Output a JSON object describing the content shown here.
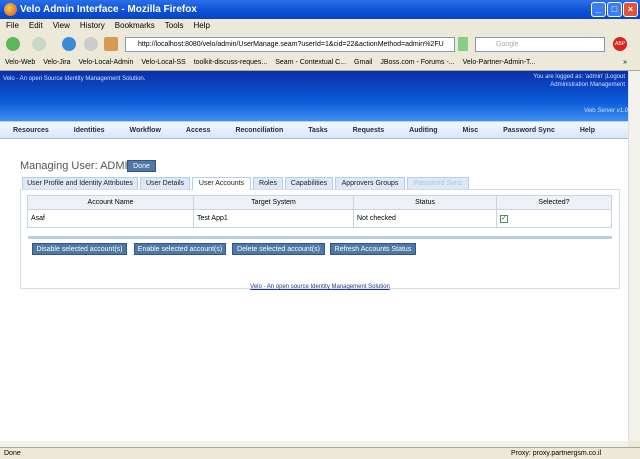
{
  "window": {
    "title": "Velo Admin Interface - Mozilla Firefox"
  },
  "menu": [
    "File",
    "Edit",
    "View",
    "History",
    "Bookmarks",
    "Tools",
    "Help"
  ],
  "toolbar": {
    "url": "http://localhost:8080/velo/admin/UserManage.seam?userId=1&cid=22&actionMethod=admin%2FU",
    "search_placeholder": "Google"
  },
  "bookmarks": [
    "Velo-Web",
    "Velo-Jira",
    "Velo-Local-Admin",
    "Velo-Local-SS",
    "toolkit-discuss-reques...",
    "Seam - Contextual C...",
    "Gmail",
    "JBoss.com - Forums -...",
    "Velo-Partner-Admin-T...",
    "»"
  ],
  "header": {
    "tagline": "Velo - An open Source Identity Management Solution.",
    "logged": "You are logged as: 'admin' |Logout",
    "admin": "Administration Management",
    "version": "Velo Server v1.0"
  },
  "nav": [
    "Resources",
    "Identities",
    "Workflow",
    "Access",
    "Reconciliation",
    "Tasks",
    "Requests",
    "Auditing",
    "Misc",
    "Password Sync",
    "Help"
  ],
  "page": {
    "title": "Managing User: ADMIN",
    "done": "Done"
  },
  "tabs": [
    "User Profile and Identity Attributes",
    "User Details",
    "User Accounts",
    "Roles",
    "Capabilities",
    "Approvers Groups",
    "Password Sync"
  ],
  "table": {
    "headers": [
      "Account Name",
      "Target System",
      "Status",
      "Selected?"
    ],
    "rows": [
      [
        "Asaf",
        "Test App1",
        "Not checked"
      ]
    ]
  },
  "buttons": [
    "Disable selected account(s)",
    "Enable selected account(s)",
    "Delete selected account(s)",
    "Refresh Accounts Status"
  ],
  "footer": "Velo - An open source Identity Management Solution",
  "status": {
    "text": "Done",
    "proxy": "Proxy: proxy.partnergsm.co.il"
  }
}
